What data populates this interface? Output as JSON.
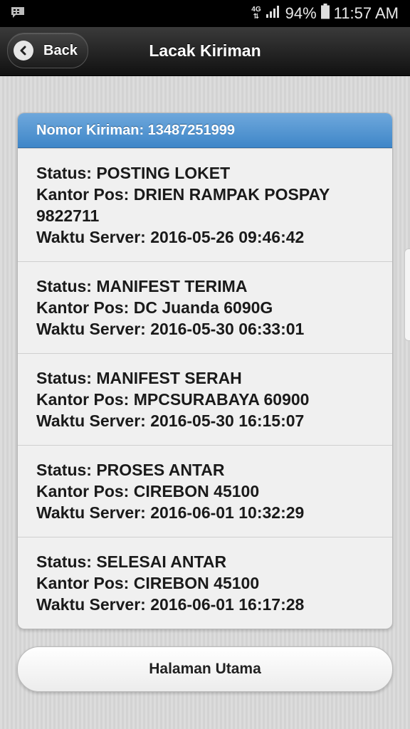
{
  "status_bar": {
    "network": "4G",
    "battery": "94%",
    "time": "11:57 AM"
  },
  "header": {
    "back_label": "Back",
    "title": "Lacak Kiriman"
  },
  "shipment": {
    "header": "Nomor Kiriman: 13487251999",
    "items": [
      {
        "status": "Status: POSTING LOKET",
        "office": "Kantor Pos: DRIEN RAMPAK POSPAY 9822711",
        "time": "Waktu Server: 2016-05-26 09:46:42"
      },
      {
        "status": "Status: MANIFEST TERIMA",
        "office": "Kantor Pos: DC Juanda 6090G",
        "time": "Waktu Server: 2016-05-30 06:33:01"
      },
      {
        "status": "Status: MANIFEST SERAH",
        "office": "Kantor Pos: MPCSURABAYA 60900",
        "time": "Waktu Server: 2016-05-30 16:15:07"
      },
      {
        "status": "Status: PROSES ANTAR",
        "office": "Kantor Pos: CIREBON 45100",
        "time": "Waktu Server: 2016-06-01 10:32:29"
      },
      {
        "status": "Status: SELESAI ANTAR",
        "office": "Kantor Pos: CIREBON 45100",
        "time": "Waktu Server: 2016-06-01 16:17:28"
      }
    ]
  },
  "footer": {
    "home_label": "Halaman Utama"
  }
}
